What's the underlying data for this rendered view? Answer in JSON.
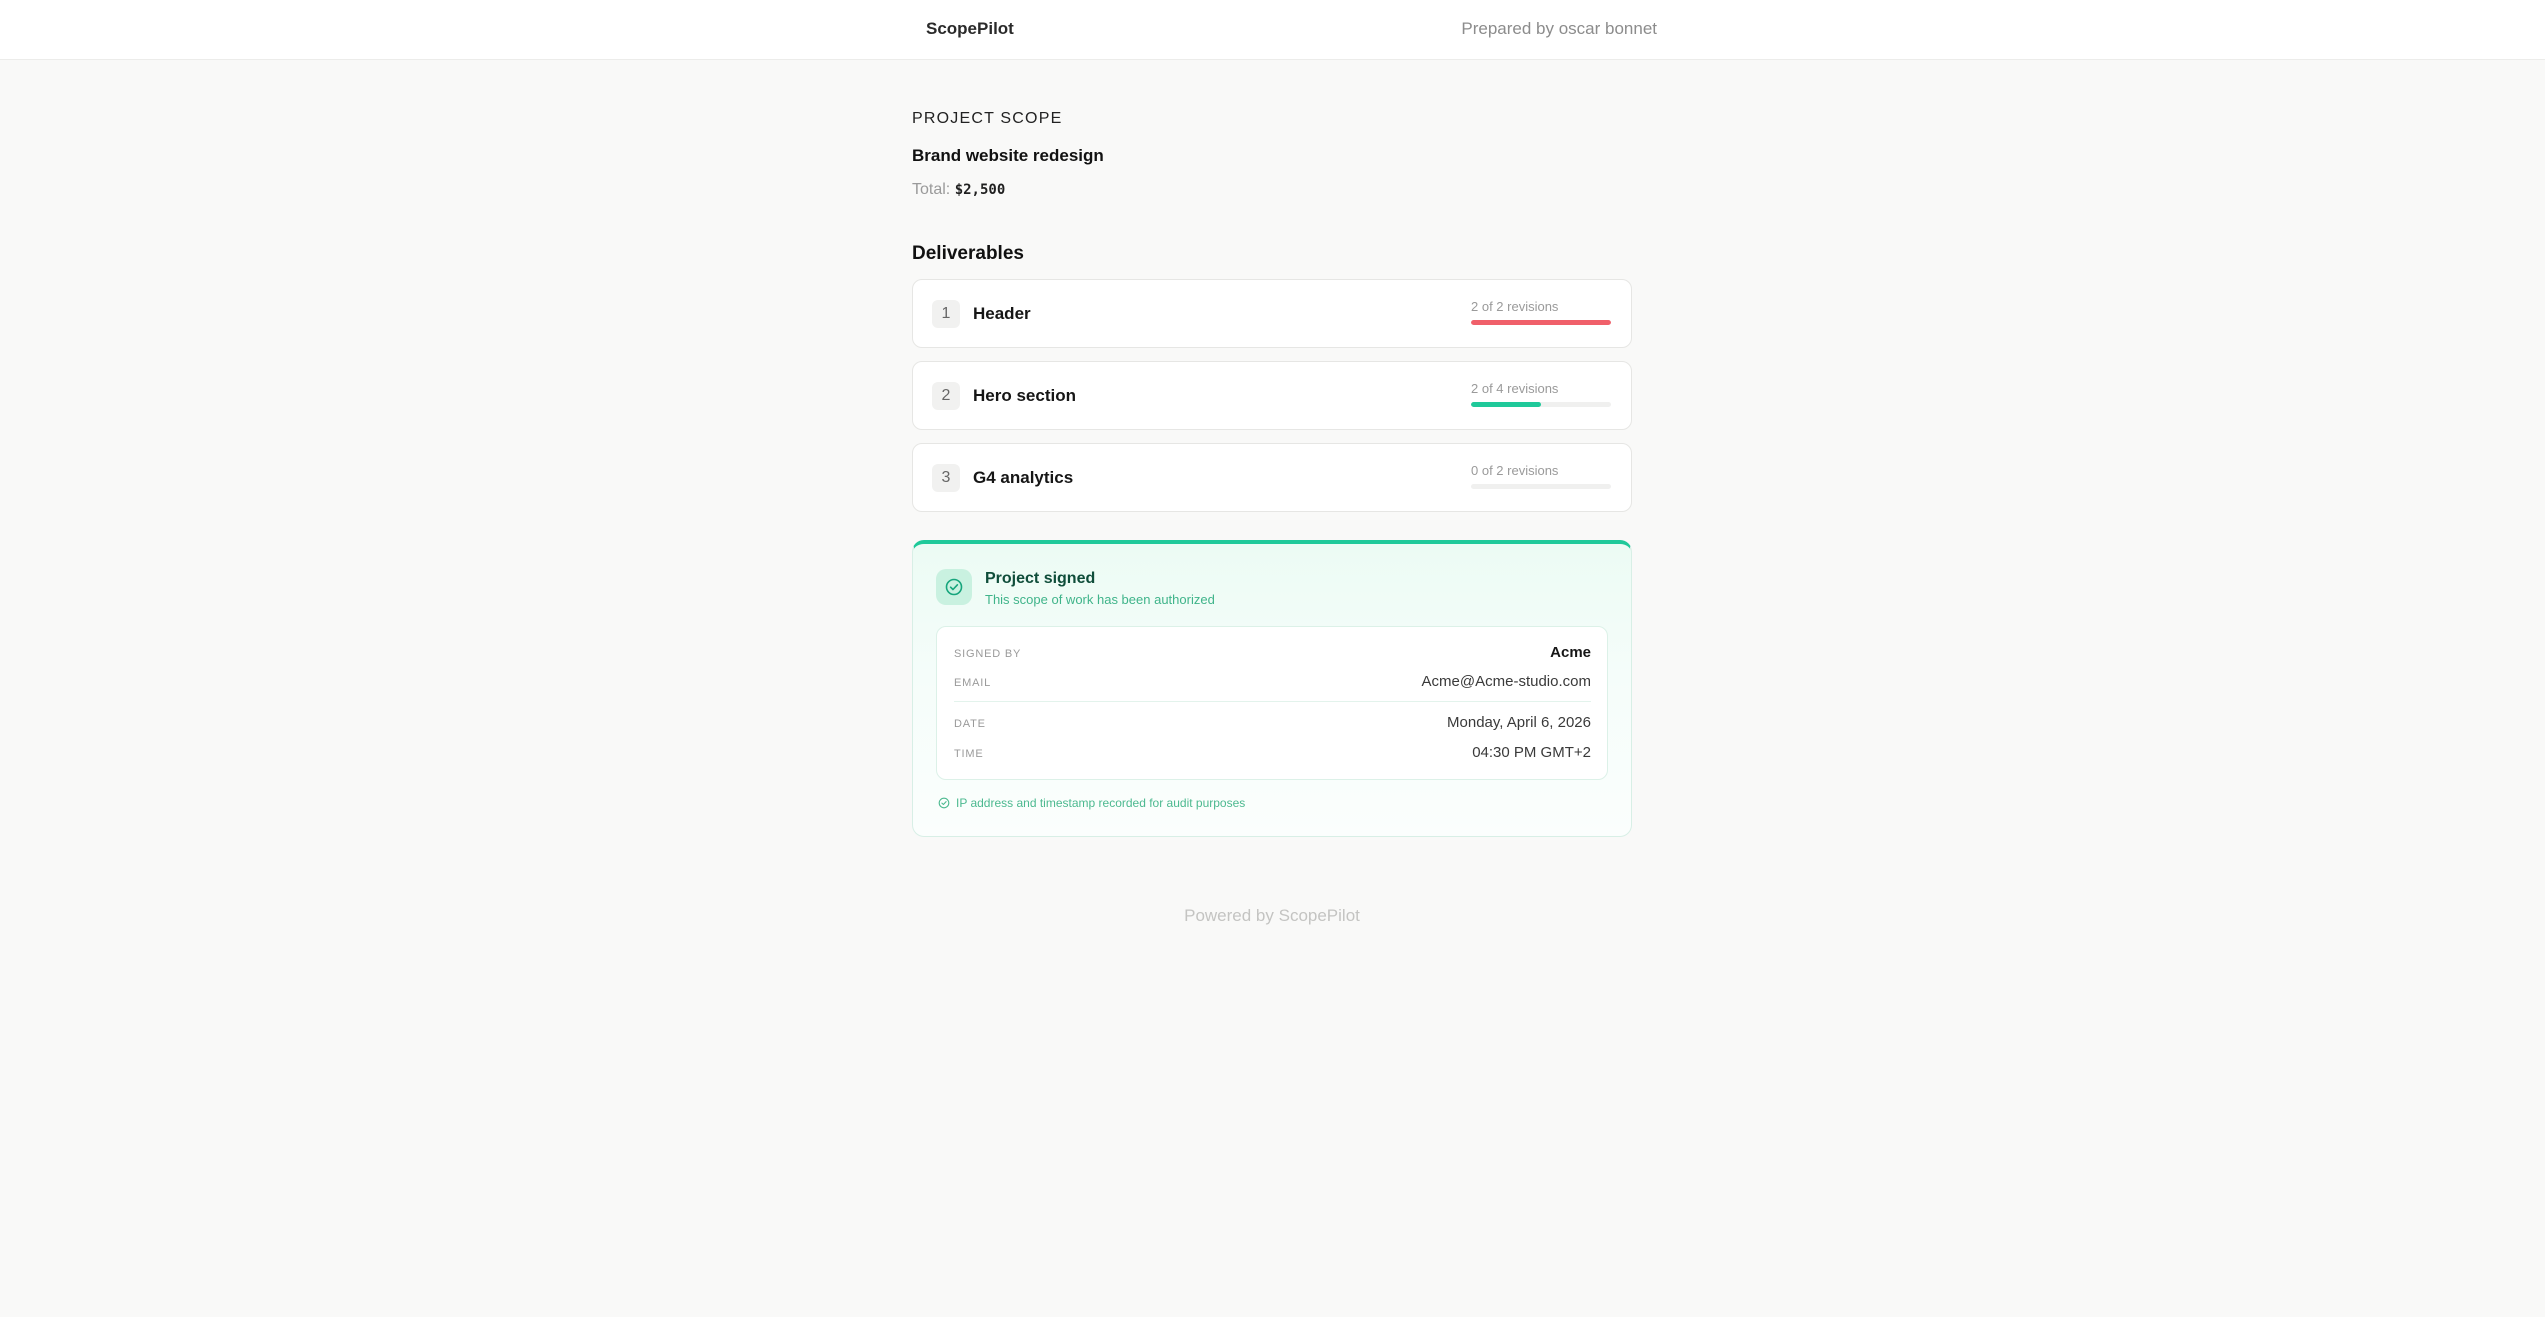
{
  "header": {
    "brand": "ScopePilot",
    "prepared_by": "Prepared by oscar bonnet"
  },
  "scope": {
    "eyebrow": "PROJECT SCOPE",
    "title": "Brand website redesign",
    "total_label": "Total:",
    "total_value": "$2,500"
  },
  "deliverables": {
    "heading": "Deliverables",
    "items": [
      {
        "index": "1",
        "name": "Header",
        "revisions": "2 of 2 revisions",
        "progress": 1.0,
        "color": "#f0606a"
      },
      {
        "index": "2",
        "name": "Hero section",
        "revisions": "2 of 4 revisions",
        "progress": 0.5,
        "color": "#1fc99a"
      },
      {
        "index": "3",
        "name": "G4 analytics",
        "revisions": "0 of 2 revisions",
        "progress": 0.0,
        "color": "#1fc99a"
      }
    ]
  },
  "signature": {
    "title": "Project signed",
    "subtitle": "This scope of work has been authorized",
    "signed_by_label": "SIGNED BY",
    "signed_by_value": "Acme",
    "email_label": "EMAIL",
    "email_value": "Acme@Acme-studio.com",
    "date_label": "DATE",
    "date_value": "Monday, April 6, 2026",
    "time_label": "TIME",
    "time_value": "04:30 PM GMT+2",
    "audit_note": "IP address and timestamp recorded for audit purposes",
    "accent_color": "#1fc99a",
    "icon": "check-circle-icon"
  },
  "footer": {
    "text": "Powered by ScopePilot"
  }
}
